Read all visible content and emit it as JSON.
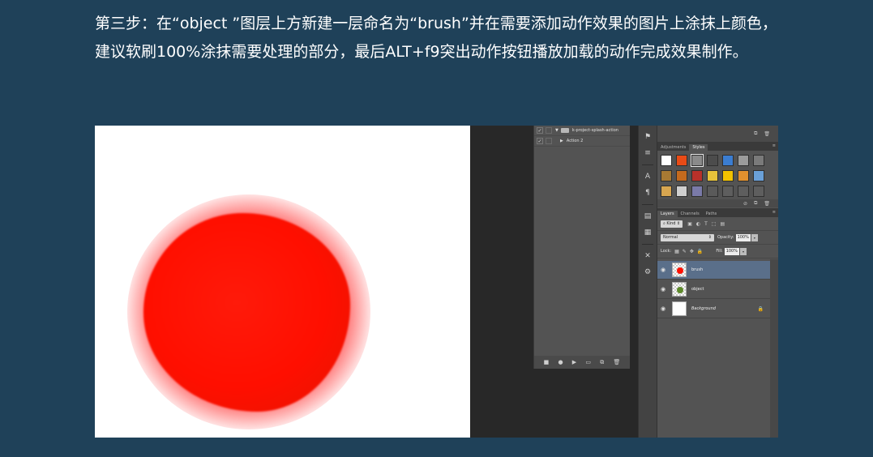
{
  "instruction": {
    "text": "第三步：在“object ”图层上方新建一层命名为“brush”并在需要添加动作效果的图片上涂抹上颜色，建议软刷100%涂抹需要处理的部分，最后ALT+f9突出动作按钮播放加载的动作完成效果制作。"
  },
  "actions": {
    "rows": [
      {
        "label": "k-project-splash-action",
        "checked": true,
        "arrow": "▼",
        "has_folder": true
      },
      {
        "label": "Action 2",
        "checked": true,
        "arrow": "▶",
        "has_folder": false
      }
    ],
    "footer_icons": [
      "stop-icon",
      "record-icon",
      "play-icon",
      "folder-icon",
      "new-action-icon",
      "trash-icon"
    ]
  },
  "tools": {
    "icons": [
      "history-brush-icon",
      "brush-settings-icon",
      "character-icon",
      "paragraph-icon",
      "layer-comps-icon",
      "notes-icon",
      "tools-cross-icon",
      "3d-icon"
    ]
  },
  "adjustments_panel": {
    "tabs": [
      {
        "label": "Adjustments",
        "active": false
      },
      {
        "label": "Styles",
        "active": true
      }
    ],
    "swatch_colors": [
      "#ffffff",
      "#e94b16",
      "#8a8a8a",
      "#4c4c4c",
      "#3b7dd1",
      "#9b9b9b",
      "#7a7a7a",
      "#a87a33",
      "#c46a1d",
      "#b9312a",
      "#e6c23a",
      "#f2c200",
      "#e0902e",
      "#6aa0d8",
      "#d8a650",
      "#cfcfcf",
      "#7a7aa8",
      "#5a5a5a",
      "#5e5e5e",
      "#5e5e5e",
      "#5e5e5e"
    ]
  },
  "layers_panel": {
    "tabs": [
      {
        "label": "Layers",
        "active": true
      },
      {
        "label": "Channels",
        "active": false
      },
      {
        "label": "Paths",
        "active": false
      }
    ],
    "filter_label": "Kind",
    "blend_mode": "Normal",
    "opacity_label": "Opacity:",
    "opacity_value": "100%",
    "lock_label": "Lock:",
    "fill_label": "Fill:",
    "fill_value": "100%",
    "layers": [
      {
        "name": "brush",
        "selected": true,
        "thumb": "red-dot"
      },
      {
        "name": "object",
        "selected": false,
        "thumb": "green-dot"
      },
      {
        "name": "Background",
        "selected": false,
        "thumb": "white",
        "locked": true
      }
    ]
  }
}
